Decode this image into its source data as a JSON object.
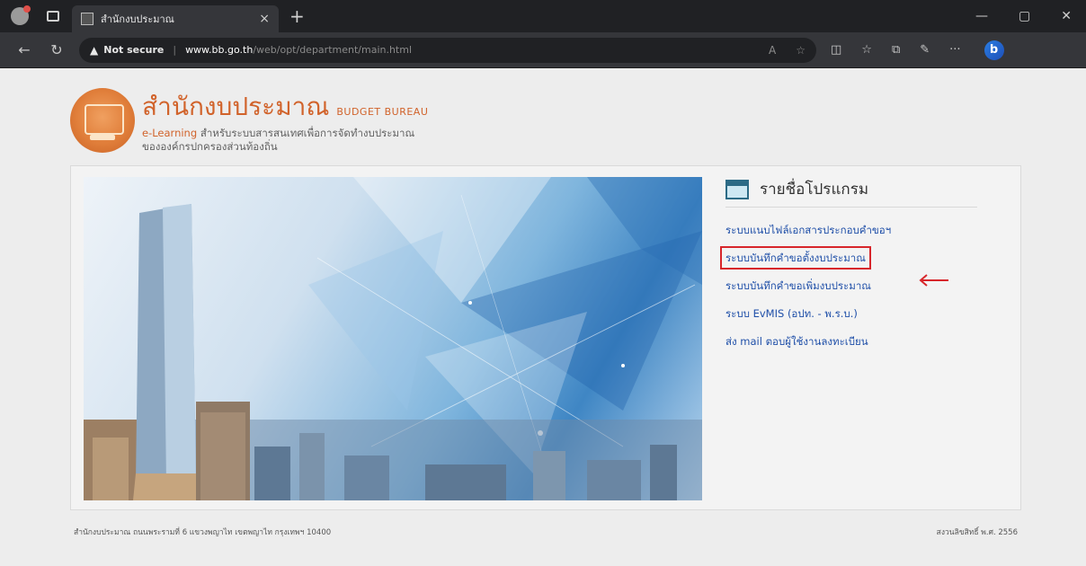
{
  "browser": {
    "tab_title": "สำนักงบประมาณ",
    "tab_close": "×",
    "new_tab": "+",
    "address": {
      "security_label": "Not secure",
      "url_host": "www.bb.go.th",
      "url_path": "/web/opt/department/main.html"
    },
    "window_controls": [
      "—",
      "▢",
      "✕"
    ]
  },
  "header": {
    "title_th": "สำนักงบประมาณ",
    "title_en": "BUDGET BUREAU",
    "subtitle_prefix": "e-Learning",
    "subtitle_line1": "สำหรับระบบสารสนเทศเพื่อการจัดทำงบประมาณ",
    "subtitle_line2": "ขององค์กรปกครองส่วนท้องถิ่น"
  },
  "menu": {
    "title": "รายชื่อโปรแกรม",
    "items": [
      "ระบบแนบไฟล์เอกสารประกอบคำขอฯ",
      "ระบบบันทึกคำขอตั้งงบประมาณ",
      "ระบบบันทึกคำขอเพิ่มงบประมาณ",
      "ระบบ EvMIS (อปท. - พ.ร.บ.)",
      "ส่ง mail ตอบผู้ใช้งานลงทะเบียน"
    ],
    "highlighted_index": 1,
    "highlight_color": "#d7262b"
  },
  "footer": {
    "address": "สำนักงบประมาณ ถนนพระรามที่ 6 แขวงพญาไท เขตพญาไท กรุงเทพฯ 10400",
    "right": "สงวนลิขสิทธิ์ พ.ศ. 2556"
  }
}
